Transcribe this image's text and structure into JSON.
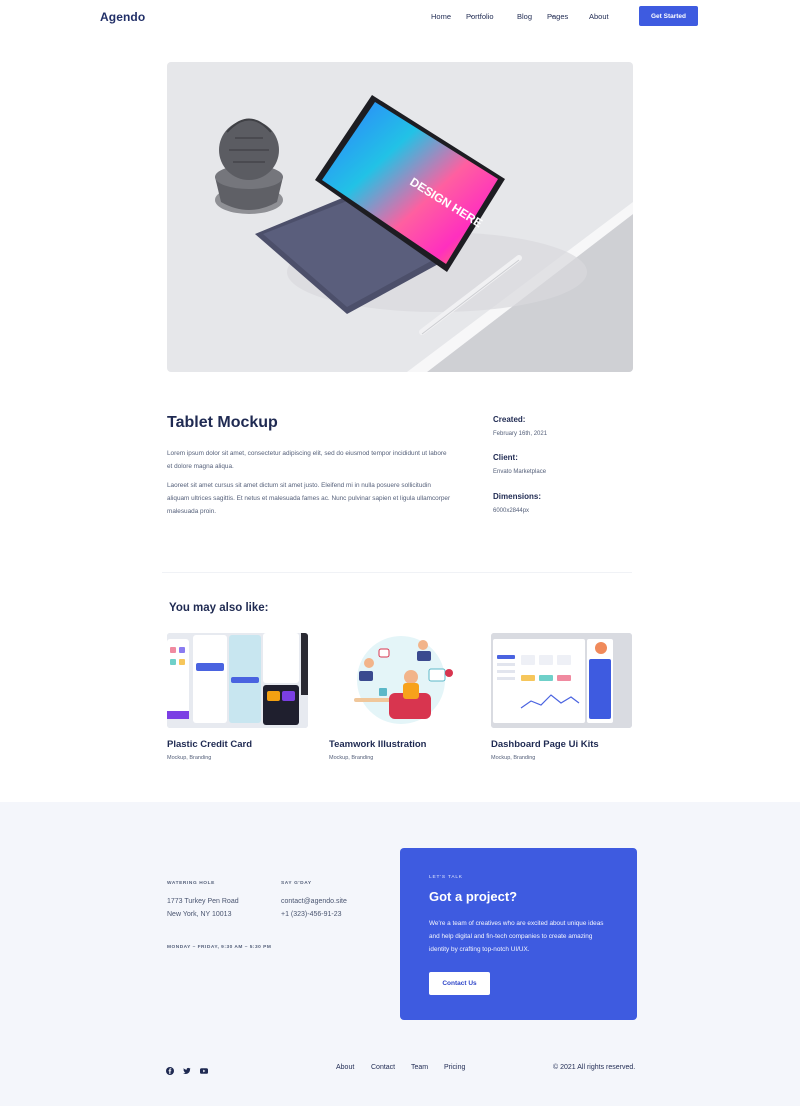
{
  "header": {
    "logo": "Agendo",
    "nav": [
      {
        "label": "Home",
        "has_dropdown": false
      },
      {
        "label": "Portfolio",
        "has_dropdown": true
      },
      {
        "label": "Blog",
        "has_dropdown": false
      },
      {
        "label": "Pages",
        "has_dropdown": true
      },
      {
        "label": "About",
        "has_dropdown": false
      }
    ],
    "cta": "Get Started"
  },
  "hero": {
    "screen_text": "DESIGN HERE"
  },
  "project": {
    "title": "Tablet Mockup",
    "paragraphs": [
      "Lorem ipsum dolor sit amet, consectetur adipiscing elit, sed do eiusmod tempor incididunt ut labore et dolore magna aliqua.",
      "Laoreet sit amet cursus sit amet dictum sit amet justo. Eleifend mi in nulla posuere sollicitudin aliquam ultrices sagittis. Et netus et malesuada fames ac. Nunc pulvinar sapien et ligula ullamcorper malesuada proin."
    ],
    "meta": [
      {
        "label": "Created:",
        "value": "February 16th, 2021"
      },
      {
        "label": "Client:",
        "value": "Envato Marketplace"
      },
      {
        "label": "Dimensions:",
        "value": "6000x2844px"
      }
    ]
  },
  "related": {
    "heading": "You may also like:",
    "items": [
      {
        "title": "Plastic Credit Card",
        "tags": "Mockup, Branding"
      },
      {
        "title": "Teamwork Illustration",
        "tags": "Mockup, Branding"
      },
      {
        "title": "Dashboard Page Ui Kits",
        "tags": "Mockup, Branding"
      }
    ]
  },
  "footer": {
    "address_label": "WATERING HOLE",
    "address_line1": "1773 Turkey Pen Road",
    "address_line2": "New York, NY 10013",
    "contact_label": "SAY G'DAY",
    "email": "contact@agendo.site",
    "phone": "+1 (323)-456-91-23",
    "hours": "MONDAY – FRIDAY, 9:30 AM – 5:30 PM",
    "talk": {
      "eyebrow": "LET'S TALK",
      "title": "Got a project?",
      "body": "We're a team of creatives who are excited about unique ideas and help digital and fin-tech companies to create amazing identity by crafting top-notch UI/UX.",
      "button": "Contact Us"
    },
    "social_icons": [
      "facebook-icon",
      "twitter-icon",
      "youtube-icon"
    ],
    "links": [
      "About",
      "Contact",
      "Team",
      "Pricing"
    ],
    "copyright": "© 2021 All rights reserved."
  },
  "colors": {
    "accent": "#3e5be0",
    "heading": "#1f2a52",
    "footer_bg": "#f4f6fb"
  }
}
